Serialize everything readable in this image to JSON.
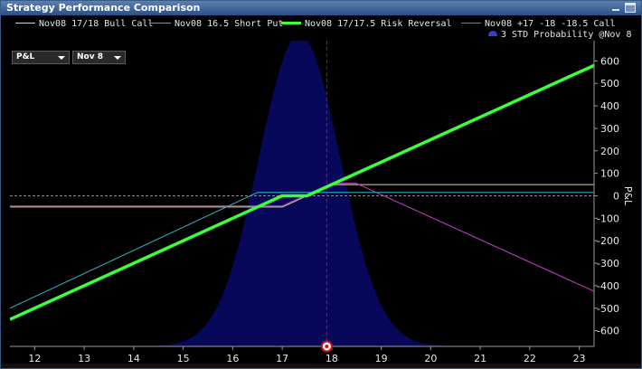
{
  "window": {
    "title": "Strategy Performance Comparison"
  },
  "legend": {
    "s1": "Nov08 17/18 Bull Call",
    "s2": "Nov08 16.5 Short Put",
    "s3": "Nov08 17/17.5 Risk Reversal",
    "s4": "Nov08  +17  -18  -18.5 Call",
    "prob": "3 STD Probability @Nov 8"
  },
  "controls": {
    "metric": "P&L",
    "date": "Nov 8"
  },
  "colors": {
    "bull_call": "#d8dc96",
    "short_put": "#2fb5c8",
    "risk_reversal": "#3cff3c",
    "call_spread": "#d23cd2",
    "probability": "#08085a",
    "marker": "#d01018"
  },
  "chart_data": {
    "type": "line",
    "xlim": [
      11.5,
      23.3
    ],
    "ylim": [
      -670,
      690
    ],
    "xlabel": "",
    "ylabel": "P&L",
    "x_ticks": [
      12,
      13,
      14,
      15,
      16,
      17,
      18,
      19,
      20,
      21,
      22,
      23
    ],
    "y_ticks": [
      -600,
      -500,
      -400,
      -300,
      -200,
      -100,
      0,
      100,
      200,
      300,
      400,
      500,
      600
    ],
    "current_price": 17.9,
    "marker_x": 17.9,
    "grid": false,
    "series": [
      {
        "name": "Nov08 17/18 Bull Call",
        "x": [
          11.5,
          17.0,
          18.0,
          23.3
        ],
        "y": [
          -50,
          -50,
          50,
          50
        ]
      },
      {
        "name": "Nov08 16.5 Short Put",
        "x": [
          11.5,
          16.5,
          23.3
        ],
        "y": [
          -500,
          15,
          15
        ]
      },
      {
        "name": "Nov08 17/17.5 Risk Reversal",
        "x": [
          11.5,
          17.0,
          17.5,
          23.3
        ],
        "y": [
          -550,
          0,
          0,
          580
        ]
      },
      {
        "name": "Nov08  +17  -18  -18.5 Call",
        "x": [
          11.5,
          17.0,
          18.0,
          18.5,
          23.3
        ],
        "y": [
          -45,
          -45,
          55,
          55,
          -425
        ]
      }
    ],
    "probability": {
      "mean": 17.35,
      "std_dev": 0.82
    }
  }
}
